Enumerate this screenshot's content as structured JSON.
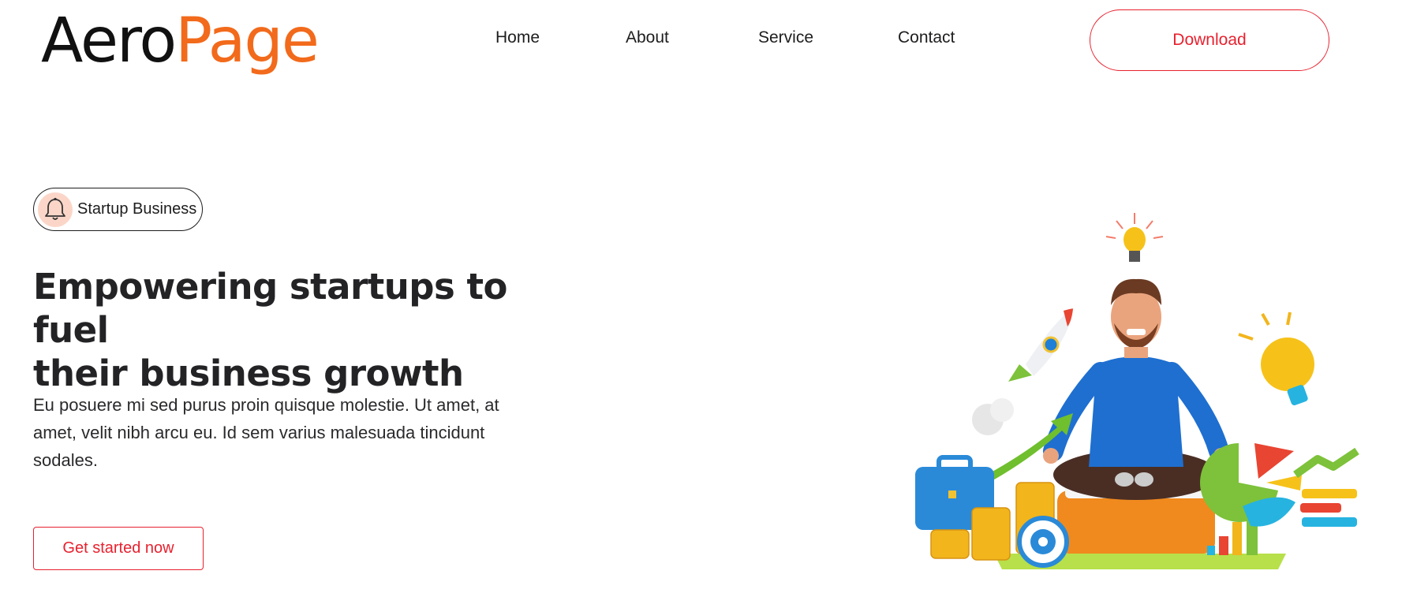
{
  "brand": {
    "logo_part1": "Aero",
    "logo_part2": "Page",
    "accent_color": "#f26a1b"
  },
  "nav": {
    "items": [
      {
        "label": "Home"
      },
      {
        "label": "About"
      },
      {
        "label": "Service"
      },
      {
        "label": "Contact"
      }
    ],
    "download_label": "Download"
  },
  "hero": {
    "badge_label": "Startup Business",
    "badge_icon": "bell-icon",
    "title_lines": [
      "Empowering startups to fuel",
      "their business growth"
    ],
    "text_lines": [
      "Eu posuere mi sed purus proin quisque molestie. Ut amet, at",
      "amet, velit nibh arcu eu. Id sem varius malesuada tincidunt",
      "sodales."
    ],
    "cta_label": "Get started now"
  },
  "colors": {
    "cta": "#e8212f",
    "text": "#232326"
  }
}
